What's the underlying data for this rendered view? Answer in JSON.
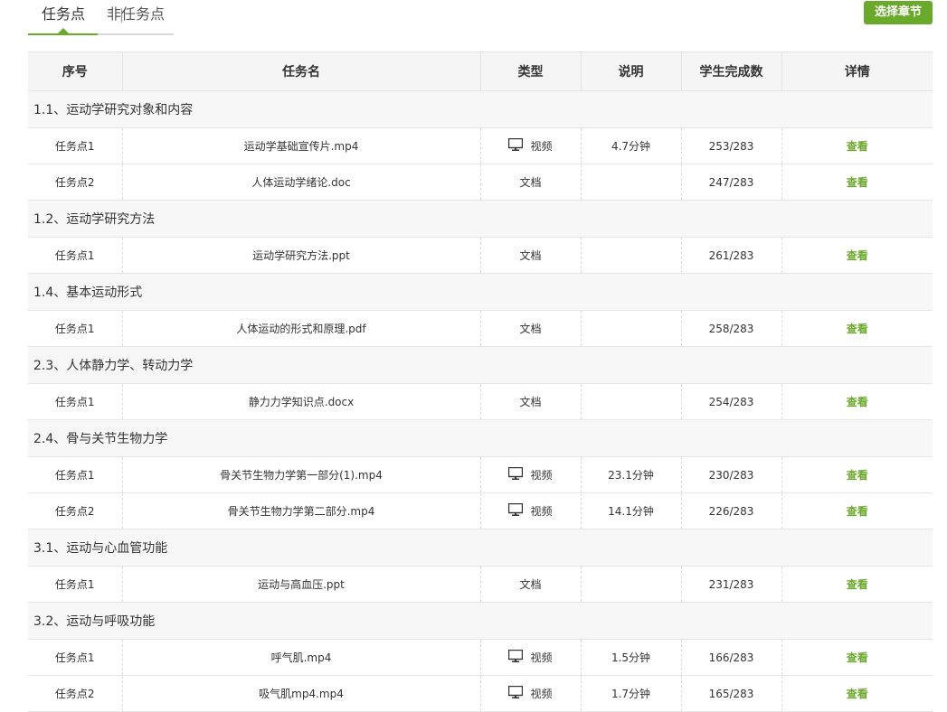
{
  "tabs": [
    {
      "label": "任务点",
      "active": true
    },
    {
      "label": "非任务点",
      "active": false
    }
  ],
  "tab_separator": "|",
  "chapter_button": "选择章节",
  "columns": [
    "序号",
    "任务名",
    "类型",
    "说明",
    "学生完成数",
    "详情"
  ],
  "colors": {
    "accent": "#6aaa2a",
    "header_bg": "#f5f5f5",
    "section_bg": "#f7f7f7"
  },
  "sections": [
    {
      "title": "1.1、运动学研究对象和内容",
      "tasks": [
        {
          "index": "任务点1",
          "name": "运动学基础宣传片.mp4",
          "type": "视频",
          "icon": "monitor-icon",
          "desc": "4.7分钟",
          "done": "253/283",
          "detail": "查看"
        },
        {
          "index": "任务点2",
          "name": "人体运动学绪论.doc",
          "type": "文档",
          "icon": "",
          "desc": "",
          "done": "247/283",
          "detail": "查看"
        }
      ]
    },
    {
      "title": "1.2、运动学研究方法",
      "tasks": [
        {
          "index": "任务点1",
          "name": "运动学研究方法.ppt",
          "type": "文档",
          "icon": "",
          "desc": "",
          "done": "261/283",
          "detail": "查看"
        }
      ]
    },
    {
      "title": "1.4、基本运动形式",
      "tasks": [
        {
          "index": "任务点1",
          "name": "人体运动的形式和原理.pdf",
          "type": "文档",
          "icon": "",
          "desc": "",
          "done": "258/283",
          "detail": "查看"
        }
      ]
    },
    {
      "title": "2.3、人体静力学、转动力学",
      "tasks": [
        {
          "index": "任务点1",
          "name": "静力力学知识点.docx",
          "type": "文档",
          "icon": "",
          "desc": "",
          "done": "254/283",
          "detail": "查看"
        }
      ]
    },
    {
      "title": "2.4、骨与关节生物力学",
      "tasks": [
        {
          "index": "任务点1",
          "name": "骨关节生物力学第一部分(1).mp4",
          "type": "视频",
          "icon": "monitor-icon",
          "desc": "23.1分钟",
          "done": "230/283",
          "detail": "查看"
        },
        {
          "index": "任务点2",
          "name": "骨关节生物力学第二部分.mp4",
          "type": "视频",
          "icon": "monitor-icon",
          "desc": "14.1分钟",
          "done": "226/283",
          "detail": "查看"
        }
      ]
    },
    {
      "title": "3.1、运动与心血管功能",
      "tasks": [
        {
          "index": "任务点1",
          "name": "运动与高血压.ppt",
          "type": "文档",
          "icon": "",
          "desc": "",
          "done": "231/283",
          "detail": "查看"
        }
      ]
    },
    {
      "title": "3.2、运动与呼吸功能",
      "tasks": [
        {
          "index": "任务点1",
          "name": "呼气肌.mp4",
          "type": "视频",
          "icon": "monitor-icon",
          "desc": "1.5分钟",
          "done": "166/283",
          "detail": "查看"
        },
        {
          "index": "任务点2",
          "name": "吸气肌mp4.mp4",
          "type": "视频",
          "icon": "monitor-icon",
          "desc": "1.7分钟",
          "done": "165/283",
          "detail": "查看"
        }
      ]
    }
  ]
}
